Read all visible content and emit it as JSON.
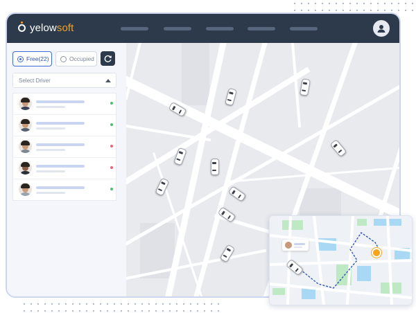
{
  "brand": {
    "prefix": "yelow",
    "suffix": "soft"
  },
  "nav": {
    "items": [
      "",
      "",
      "",
      "",
      ""
    ]
  },
  "filters": {
    "free_label": "Free(22)",
    "occupied_label": "Occupied"
  },
  "select_driver": {
    "placeholder": "Select Driver"
  },
  "drivers": [
    {
      "status": "free"
    },
    {
      "status": "free"
    },
    {
      "status": "occupied"
    },
    {
      "status": "occupied"
    },
    {
      "status": "free"
    }
  ],
  "colors": {
    "header_bg": "#2c3a4c",
    "accent_orange": "#f6a21a",
    "primary_blue": "#3d6bd6",
    "status_free": "#46c36d",
    "status_occupied": "#f0617a"
  },
  "icons": {
    "avatar": "user-icon",
    "refresh": "refresh-icon",
    "caret": "chevron-up-icon",
    "destination": "location-pin-icon"
  }
}
